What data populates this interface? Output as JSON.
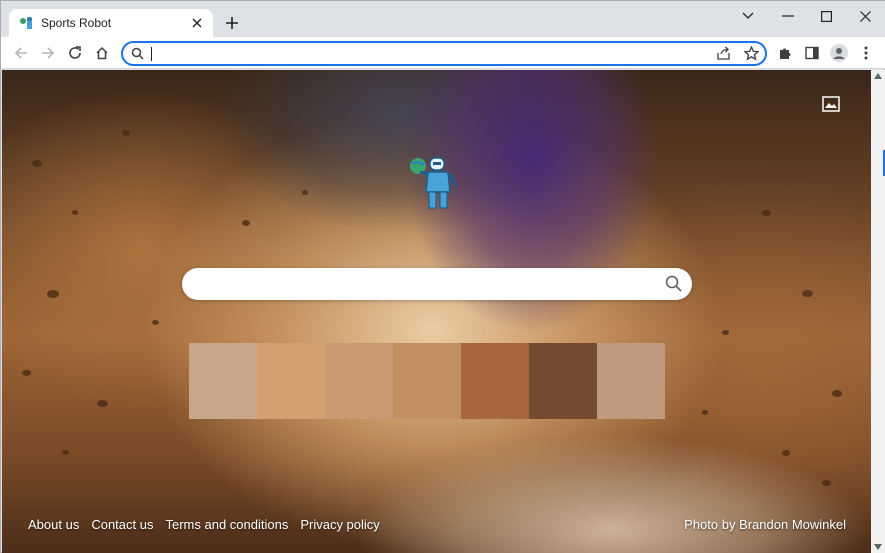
{
  "browser": {
    "tab": {
      "title": "Sports Robot",
      "favicon": "robot-favicon-icon",
      "close_icon": "close-icon"
    },
    "new_tab_icon": "plus-icon",
    "window_controls": [
      "chevron-down-icon",
      "minimize-icon",
      "maximize-icon",
      "close-icon"
    ],
    "toolbar": {
      "back_icon": "arrow-left-icon",
      "forward_icon": "arrow-right-icon",
      "reload_icon": "reload-icon",
      "home_icon": "home-icon",
      "omnibox": {
        "value": "",
        "placeholder": ""
      },
      "share_icon": "share-icon",
      "bookmark_icon": "star-icon",
      "extensions_icon": "puzzle-icon",
      "side_panel_icon": "side-panel-icon",
      "profile_icon": "person-icon",
      "menu_icon": "kebab-menu-icon"
    },
    "accent_color": "#1a73e8"
  },
  "page": {
    "search": {
      "value": "",
      "placeholder": ""
    },
    "wallpaper_icon": "image-icon",
    "tiles": [
      {
        "color": "#c7a689"
      },
      {
        "color": "#d4a070"
      },
      {
        "color": "#c99a72"
      },
      {
        "color": "#c18f61"
      },
      {
        "color": "#a7663c"
      },
      {
        "color": "#754b32"
      },
      {
        "color": "#c09a7f"
      }
    ],
    "footer": {
      "links": [
        "About us",
        "Contact us",
        "Terms and conditions",
        "Privacy policy"
      ],
      "photo_credit": "Photo by Brandon Mowinkel"
    }
  }
}
